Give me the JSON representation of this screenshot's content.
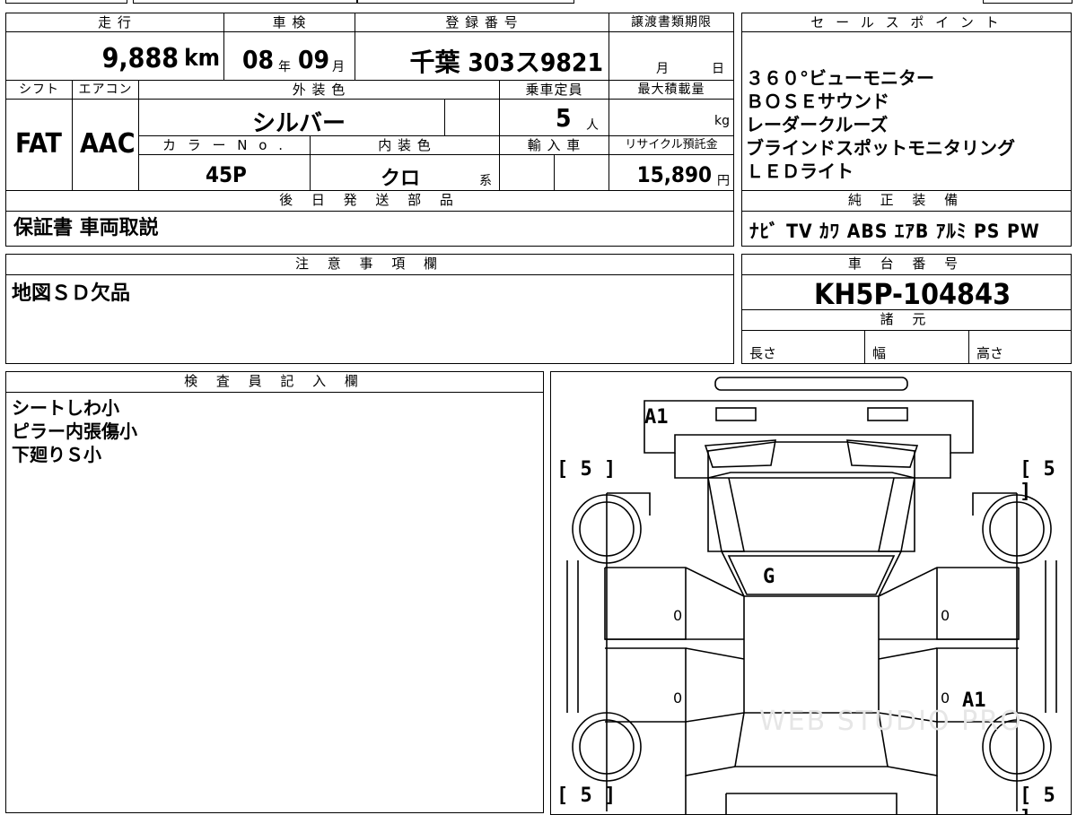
{
  "headers": {
    "mileage": "走 行",
    "inspection": "車 検",
    "registration": "登 録 番 号",
    "transfer_deadline": "譲渡書類期限",
    "sales_point": "セ ー ル ス ポ イ ン ト",
    "shift": "シフト",
    "aircon": "エアコン",
    "exterior_color": "外 装 色",
    "capacity": "乗車定員",
    "max_load": "最大積載量",
    "color_no": "カ ラ ー N o .",
    "interior_color": "内 装 色",
    "import": "輸 入 車",
    "recycle": "リサイクル預託金",
    "later_parts": "後 日 発 送 部 品",
    "genuine": "純 正 装 備",
    "notes": "注 意 事 項 欄",
    "chassis": "車 台 番 号",
    "specs": "諸 元",
    "inspector": "検 査 員 記 入 欄"
  },
  "mileage": {
    "value": "9,888",
    "unit": "km"
  },
  "inspection": {
    "year": "08",
    "year_unit": "年",
    "month": "09",
    "month_unit": "月"
  },
  "registration": {
    "value": "千葉 303ス9821"
  },
  "transfer": {
    "month_label": "月",
    "day_label": "日"
  },
  "shift": "FAT",
  "aircon": "AAC",
  "exterior_color": "シルバー",
  "capacity": {
    "value": "5",
    "unit": "人"
  },
  "max_load": {
    "unit": "kg"
  },
  "color_no": "45P",
  "interior_color": {
    "value": "クロ",
    "suffix": "系"
  },
  "recycle": {
    "value": "15,890",
    "unit": "円"
  },
  "sales_points": [
    "３６０°ビューモニター",
    "ＢＯＳＥサウンド",
    "レーダークルーズ",
    "ブラインドスポットモニタリング",
    "ＬＥＤライト"
  ],
  "later_parts": "保証書 車両取説",
  "genuine_options": "ﾅﾋﾞ TV ｶﾜ ABS ｴｱB ｱﾙﾐ PS PW",
  "notes": "地図ＳＤ欠品",
  "chassis_no": "KH5P-104843",
  "specs": {
    "length": "長さ",
    "width": "幅",
    "height": "高さ"
  },
  "inspector_notes": [
    "シートしわ小",
    "ピラー内張傷小",
    "下廻りＳ小"
  ],
  "diagram": {
    "marks": {
      "front_bumper": "A1",
      "glass": "G",
      "rear_quarter": "A1"
    },
    "tire_depth": {
      "fl": "5",
      "fr": "5",
      "rl": "5",
      "rr": "5"
    },
    "door_marks": {
      "fl": "0",
      "fr": "0",
      "rl": "0",
      "rr": "0"
    },
    "watermark": "WEB STUDIO PRO"
  }
}
